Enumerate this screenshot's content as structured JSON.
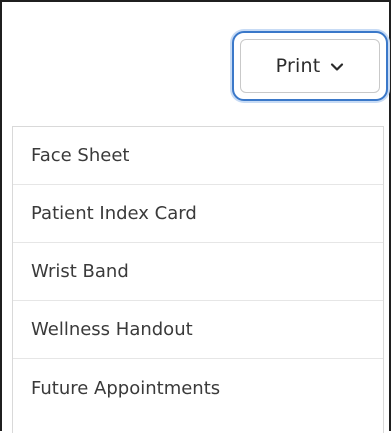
{
  "print_button": {
    "label": "Print",
    "icon": "chevron-down-icon"
  },
  "menu": {
    "items": [
      {
        "label": "Face Sheet"
      },
      {
        "label": "Patient Index Card"
      },
      {
        "label": "Wrist Band"
      },
      {
        "label": "Wellness Handout"
      },
      {
        "label": "Future Appointments"
      }
    ]
  },
  "colors": {
    "focus_ring": "#3a78c9",
    "text": "#3a3a3a",
    "divider": "#e6e6e6"
  }
}
